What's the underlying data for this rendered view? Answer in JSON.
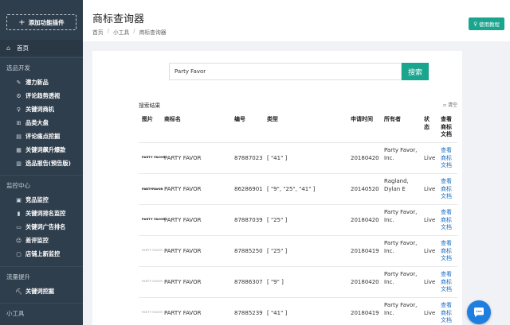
{
  "sidebar": {
    "add_plugin": "添加功能插件",
    "home": "首页",
    "groups": [
      {
        "title": "选品开发",
        "items": [
          "潜力新品",
          "评论趋势透视",
          "关键词商机",
          "品类大盘",
          "评论痛点挖掘",
          "关键词飙升爆款",
          "选品报告(预告版)"
        ]
      },
      {
        "title": "监控中心",
        "items": [
          "竞品监控",
          "关键词排名监控",
          "关键词广告排名",
          "差评监控",
          "店铺上新监控"
        ]
      },
      {
        "title": "流量提升",
        "items": [
          "关键词挖掘"
        ]
      },
      {
        "title": "小工具",
        "items": []
      }
    ]
  },
  "header": {
    "title": "商标查询器",
    "breadcrumb": [
      "首页",
      "小工具",
      "商标查询器"
    ],
    "tutorial": "使用教程"
  },
  "search": {
    "value": "Party Favor",
    "button": "搜索"
  },
  "results": {
    "label": "搜索结果",
    "clear": "清空",
    "columns": [
      "图片",
      "商标名",
      "编号",
      "类型",
      "申请时间",
      "所有者",
      "状态",
      "查看商标文档"
    ],
    "rows": [
      {
        "logo": "PARTY FAVOR",
        "name": "PARTY FAVOR",
        "number": "87887023",
        "type": "[ \"41\" ]",
        "date": "20180420",
        "owner": "Party Favor, Inc.",
        "status": "Live",
        "doc": "查看商标文档"
      },
      {
        "logo": "PARTYFAVOR",
        "name": "PARTY FAVOR",
        "number": "86286901",
        "type": "[ \"9\", \"25\", \"41\" ]",
        "date": "20140520",
        "owner": "Ragland, Dylan E",
        "status": "Live",
        "doc": "查看商标文档"
      },
      {
        "logo": "PARTY FAVOR",
        "name": "PARTY FAVOR",
        "number": "87887039",
        "type": "[ \"25\" ]",
        "date": "20180420",
        "owner": "Party Favor, Inc.",
        "status": "Live",
        "doc": "查看商标文档"
      },
      {
        "logo": "PARTY FAVOR",
        "name": "PARTY FAVOR",
        "number": "87885250",
        "type": "[ \"25\" ]",
        "date": "20180419",
        "owner": "Party Favor, Inc.",
        "status": "Live",
        "doc": "查看商标文档"
      },
      {
        "logo": "PARTY FAVOR",
        "name": "PARTY FAVOR",
        "number": "87886307",
        "type": "[ \"9\" ]",
        "date": "20180420",
        "owner": "Party Favor, Inc.",
        "status": "Live",
        "doc": "查看商标文档"
      },
      {
        "logo": "PARTY FAVOR",
        "name": "PARTY FAVOR",
        "number": "87885239",
        "type": "[ \"41\" ]",
        "date": "20180419",
        "owner": "Party Favor, Inc.",
        "status": "Live",
        "doc": "查看商标文档"
      }
    ]
  },
  "colors": {
    "accent": "#1aa58f",
    "sidebar": "#2f3e4c",
    "link": "#1a6fc4",
    "chat": "#1f7fe0"
  },
  "icons": [
    "plus-icon",
    "home-icon",
    "thumbs-up-icon",
    "chat-icon"
  ]
}
